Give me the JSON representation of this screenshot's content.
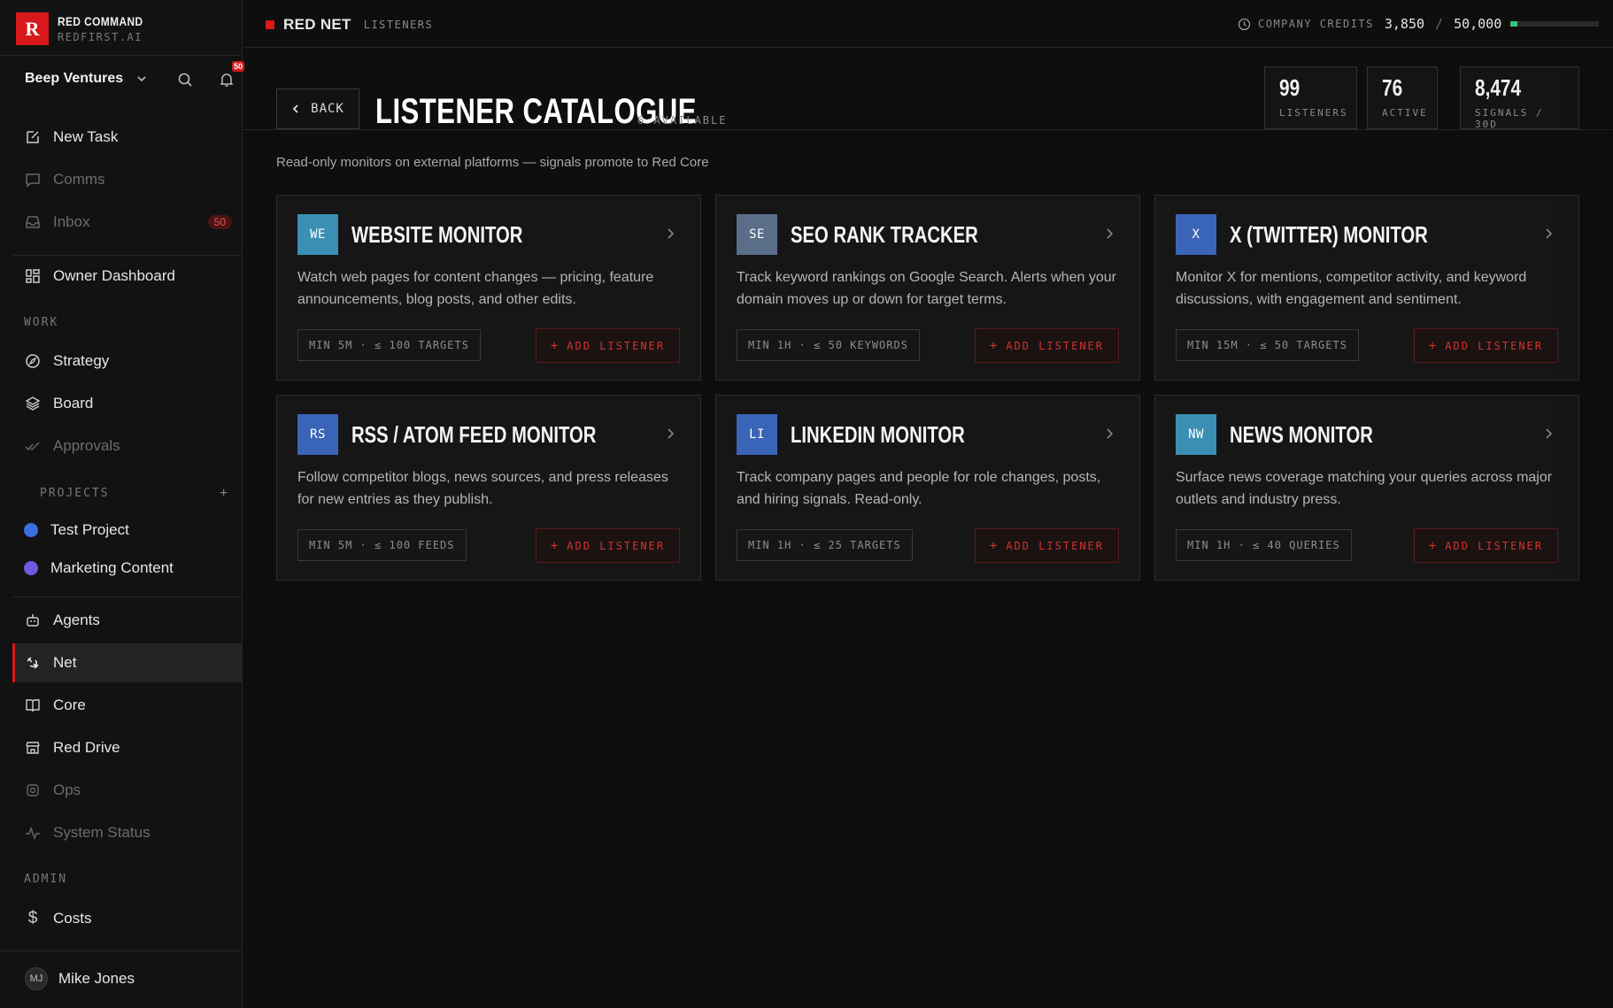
{
  "brand": {
    "logo_letter": "R",
    "name": "RED COMMAND",
    "domain": "REDFIRST.AI"
  },
  "workspace": {
    "name": "Beep Ventures",
    "notification_count": "50"
  },
  "nav": {
    "new_task": "New Task",
    "comms": "Comms",
    "inbox": "Inbox",
    "inbox_count": "50",
    "owner_dashboard": "Owner Dashboard",
    "work_label": "WORK",
    "strategy": "Strategy",
    "board": "Board",
    "approvals": "Approvals",
    "projects_label": "PROJECTS",
    "add_project": "+",
    "projects": [
      {
        "name": "Test Project",
        "color": "#3b6fe0"
      },
      {
        "name": "Marketing Content",
        "color": "#6b5be0"
      }
    ],
    "agents": "Agents",
    "net": "Net",
    "core": "Core",
    "red_drive": "Red Drive",
    "ops": "Ops",
    "system_status": "System Status",
    "admin_label": "ADMIN",
    "costs": "Costs"
  },
  "user": {
    "initials": "MJ",
    "name": "Mike Jones"
  },
  "topbar": {
    "section": "RED NET",
    "subsection": "LISTENERS",
    "credits_label": "COMPANY CREDITS",
    "credits_used": "3,850",
    "credits_separator": "/",
    "credits_total": "50,000",
    "credits_fraction": 0.077
  },
  "header": {
    "back_label": "BACK",
    "title": "LISTENER CATALOGUE",
    "available": "6 AVAILABLE",
    "subtitle": "Read-only monitors on external platforms — signals promote to Red Core"
  },
  "stats": [
    {
      "value": "99",
      "label": "LISTENERS"
    },
    {
      "value": "76",
      "label": "ACTIVE"
    },
    {
      "value": "8,474",
      "label": "SIGNALS / 30D"
    }
  ],
  "cards": [
    {
      "abbr": "WE",
      "color": "#3a8fb3",
      "title": "WEBSITE MONITOR",
      "description": "Watch web pages for content changes — pricing, feature announcements, blog posts, and other edits.",
      "meta": "MIN 5M · ≤ 100 TARGETS",
      "action": "ADD LISTENER"
    },
    {
      "abbr": "SE",
      "color": "#5a6e8a",
      "title": "SEO RANK TRACKER",
      "description": "Track keyword rankings on Google Search. Alerts when your domain moves up or down for target terms.",
      "meta": "MIN 1H · ≤ 50 KEYWORDS",
      "action": "ADD LISTENER"
    },
    {
      "abbr": "X",
      "color": "#3a64b8",
      "title": "X (TWITTER) MONITOR",
      "description": "Monitor X for mentions, competitor activity, and keyword discussions, with engagement and sentiment.",
      "meta": "MIN 15M · ≤ 50 TARGETS",
      "action": "ADD LISTENER"
    },
    {
      "abbr": "RS",
      "color": "#3a64b8",
      "title": "RSS / ATOM FEED MONITOR",
      "description": "Follow competitor blogs, news sources, and press releases for new entries as they publish.",
      "meta": "MIN 5M · ≤ 100 FEEDS",
      "action": "ADD LISTENER"
    },
    {
      "abbr": "LI",
      "color": "#3a64b8",
      "title": "LINKEDIN MONITOR",
      "description": "Track company pages and people for role changes, posts, and hiring signals. Read-only.",
      "meta": "MIN 1H · ≤ 25 TARGETS",
      "action": "ADD LISTENER"
    },
    {
      "abbr": "NW",
      "color": "#3a8fb3",
      "title": "NEWS MONITOR",
      "description": "Surface news coverage matching your queries across major outlets and industry press.",
      "meta": "MIN 1H · ≤ 40 QUERIES",
      "action": "ADD LISTENER"
    }
  ],
  "icons": {
    "new_task": "edit-icon",
    "comms": "chat-icon",
    "inbox": "inbox-icon",
    "owner_dashboard": "grid-icon",
    "strategy": "compass-icon",
    "board": "layers-icon",
    "approvals": "check-double-icon",
    "agents": "bot-icon",
    "net": "satellite-icon",
    "core": "book-icon",
    "red_drive": "store-icon",
    "ops": "gear-icon",
    "system_status": "pulse-icon",
    "costs": "dollar-icon"
  }
}
